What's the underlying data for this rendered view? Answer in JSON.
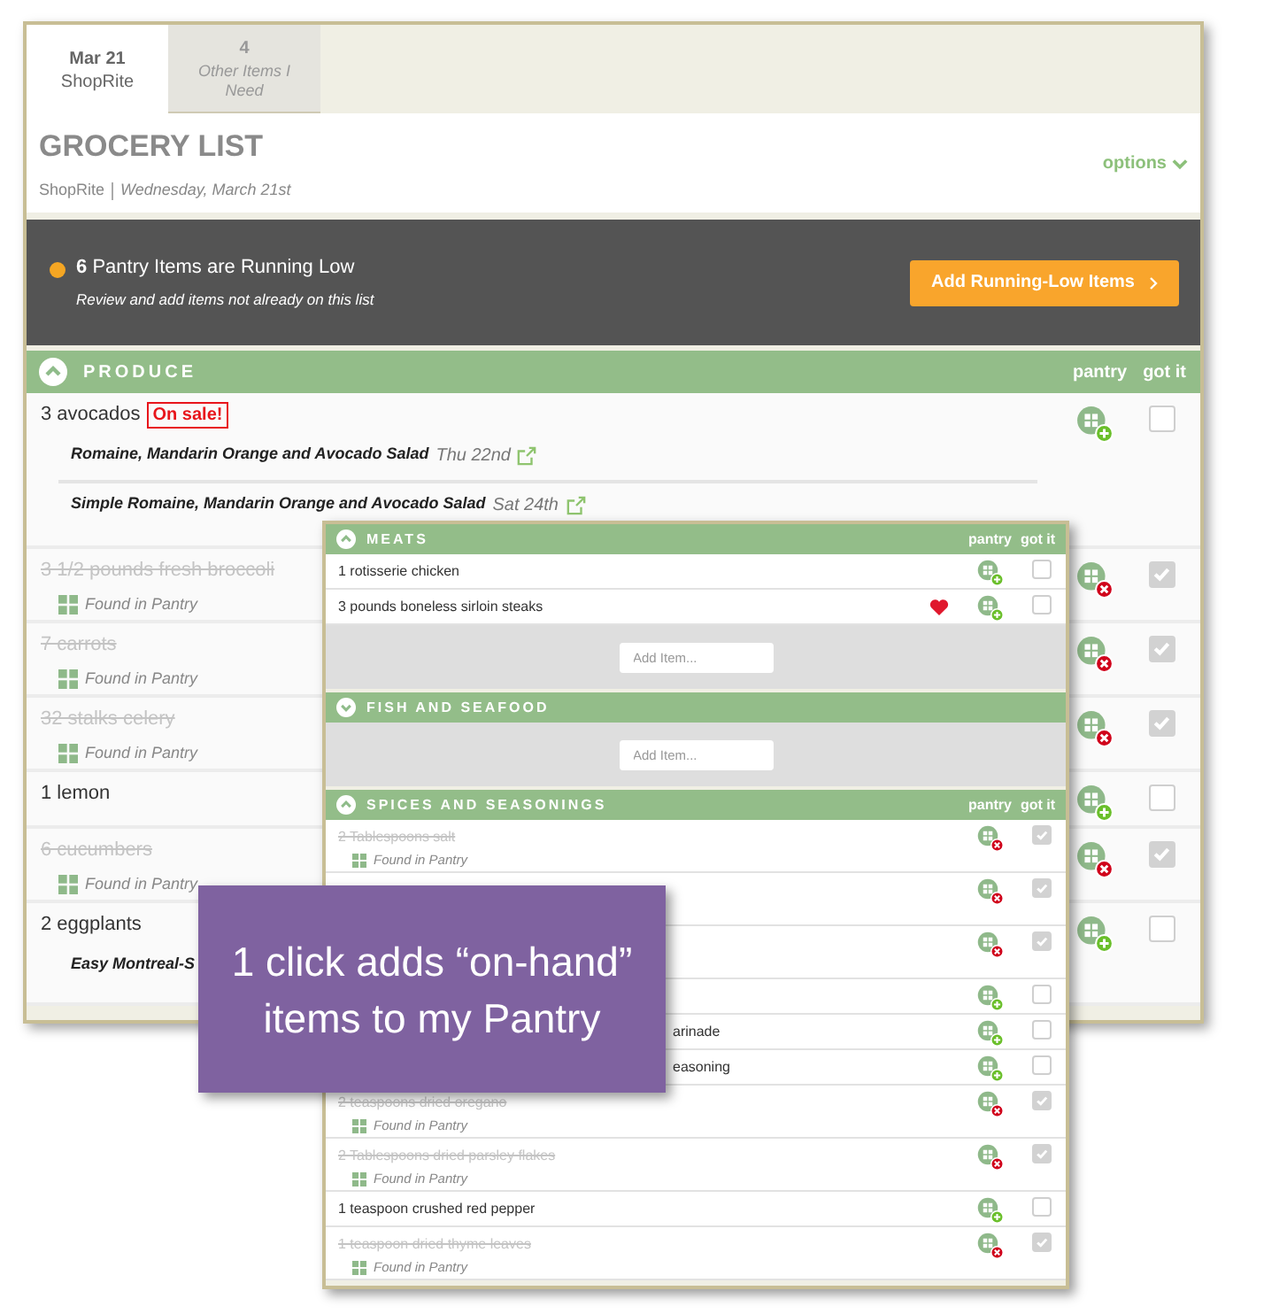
{
  "tabs": [
    {
      "title": "Mar 21",
      "subtitle": "ShopRite",
      "selected": true
    },
    {
      "title": "4",
      "subtitle": "Other Items I Need",
      "selected": false
    }
  ],
  "header": {
    "title": "GROCERY LIST",
    "store": "ShopRite",
    "date": "Wednesday, March 21st",
    "options": "options"
  },
  "alert": {
    "count": "6",
    "message": "Pantry Items are Running Low",
    "detail": "Review and add items not already on this list",
    "button": "Add Running-Low Items"
  },
  "produce": {
    "name": "PRODUCE",
    "expanded": true,
    "columns": [
      "pantry",
      "got it"
    ],
    "items": [
      {
        "name": "3 avocados",
        "badge": "On sale!",
        "in_pantry": false,
        "got_it": false,
        "recipes": [
          {
            "name": "Romaine, Mandarin Orange and Avocado Salad",
            "date": "Thu 22nd"
          },
          {
            "name": "Simple Romaine, Mandarin Orange and Avocado Salad",
            "date": "Sat 24th"
          }
        ]
      },
      {
        "name": "3 1/2 pounds fresh broccoli",
        "note": "Found in Pantry",
        "in_pantry": true,
        "got_it": true
      },
      {
        "name": "7 carrots",
        "note": "Found in Pantry",
        "in_pantry": true,
        "got_it": true
      },
      {
        "name": "32 stalks celery",
        "note": "Found in Pantry",
        "in_pantry": true,
        "got_it": true
      },
      {
        "name": "1 lemon",
        "in_pantry": false,
        "got_it": false
      },
      {
        "name": "6 cucumbers",
        "note": "Found in Pantry",
        "in_pantry": true,
        "got_it": true
      },
      {
        "name": "2 eggplants",
        "in_pantry": false,
        "got_it": false,
        "recipes": [
          {
            "name": "Easy Montreal-S"
          }
        ]
      }
    ]
  },
  "overlay": {
    "sections": [
      {
        "name": "MEATS",
        "expanded": true,
        "columns": [
          "pantry",
          "got it"
        ],
        "add_placeholder": "Add Item...",
        "items": [
          {
            "name": "1 rotisserie chicken",
            "in_pantry": false,
            "got_it": false,
            "favorite": false
          },
          {
            "name": "3 pounds boneless sirloin steaks",
            "in_pantry": false,
            "got_it": false,
            "favorite": true
          }
        ]
      },
      {
        "name": "FISH AND SEAFOOD",
        "expanded": false,
        "add_placeholder": "Add Item..."
      },
      {
        "name": "SPICES AND SEASONINGS",
        "expanded": true,
        "columns": [
          "pantry",
          "got it"
        ],
        "items": [
          {
            "name": "2 Tablespoons salt",
            "note": "Found in Pantry",
            "in_pantry": true,
            "got_it": true
          },
          {
            "in_pantry": true,
            "got_it": true
          },
          {
            "in_pantry": true,
            "got_it": true
          },
          {
            "in_pantry": false,
            "got_it": false
          },
          {
            "name": "arinade",
            "cut": true,
            "in_pantry": false,
            "got_it": false
          },
          {
            "name": "easoning",
            "cut": true,
            "in_pantry": false,
            "got_it": false
          },
          {
            "name": "2 teaspoons dried oregano",
            "note": "Found in Pantry",
            "in_pantry": true,
            "got_it": true
          },
          {
            "name": "2 Tablespoons dried parsley flakes",
            "note": "Found in Pantry",
            "in_pantry": true,
            "got_it": true
          },
          {
            "name": "1 teaspoon crushed red pepper",
            "in_pantry": false,
            "got_it": false
          },
          {
            "name": "1 teaspoon dried thyme leaves",
            "note": "Found in Pantry",
            "in_pantry": true,
            "got_it": true
          }
        ]
      }
    ]
  },
  "callout": {
    "text": "1 click adds “on-hand” items to my Pantry"
  }
}
